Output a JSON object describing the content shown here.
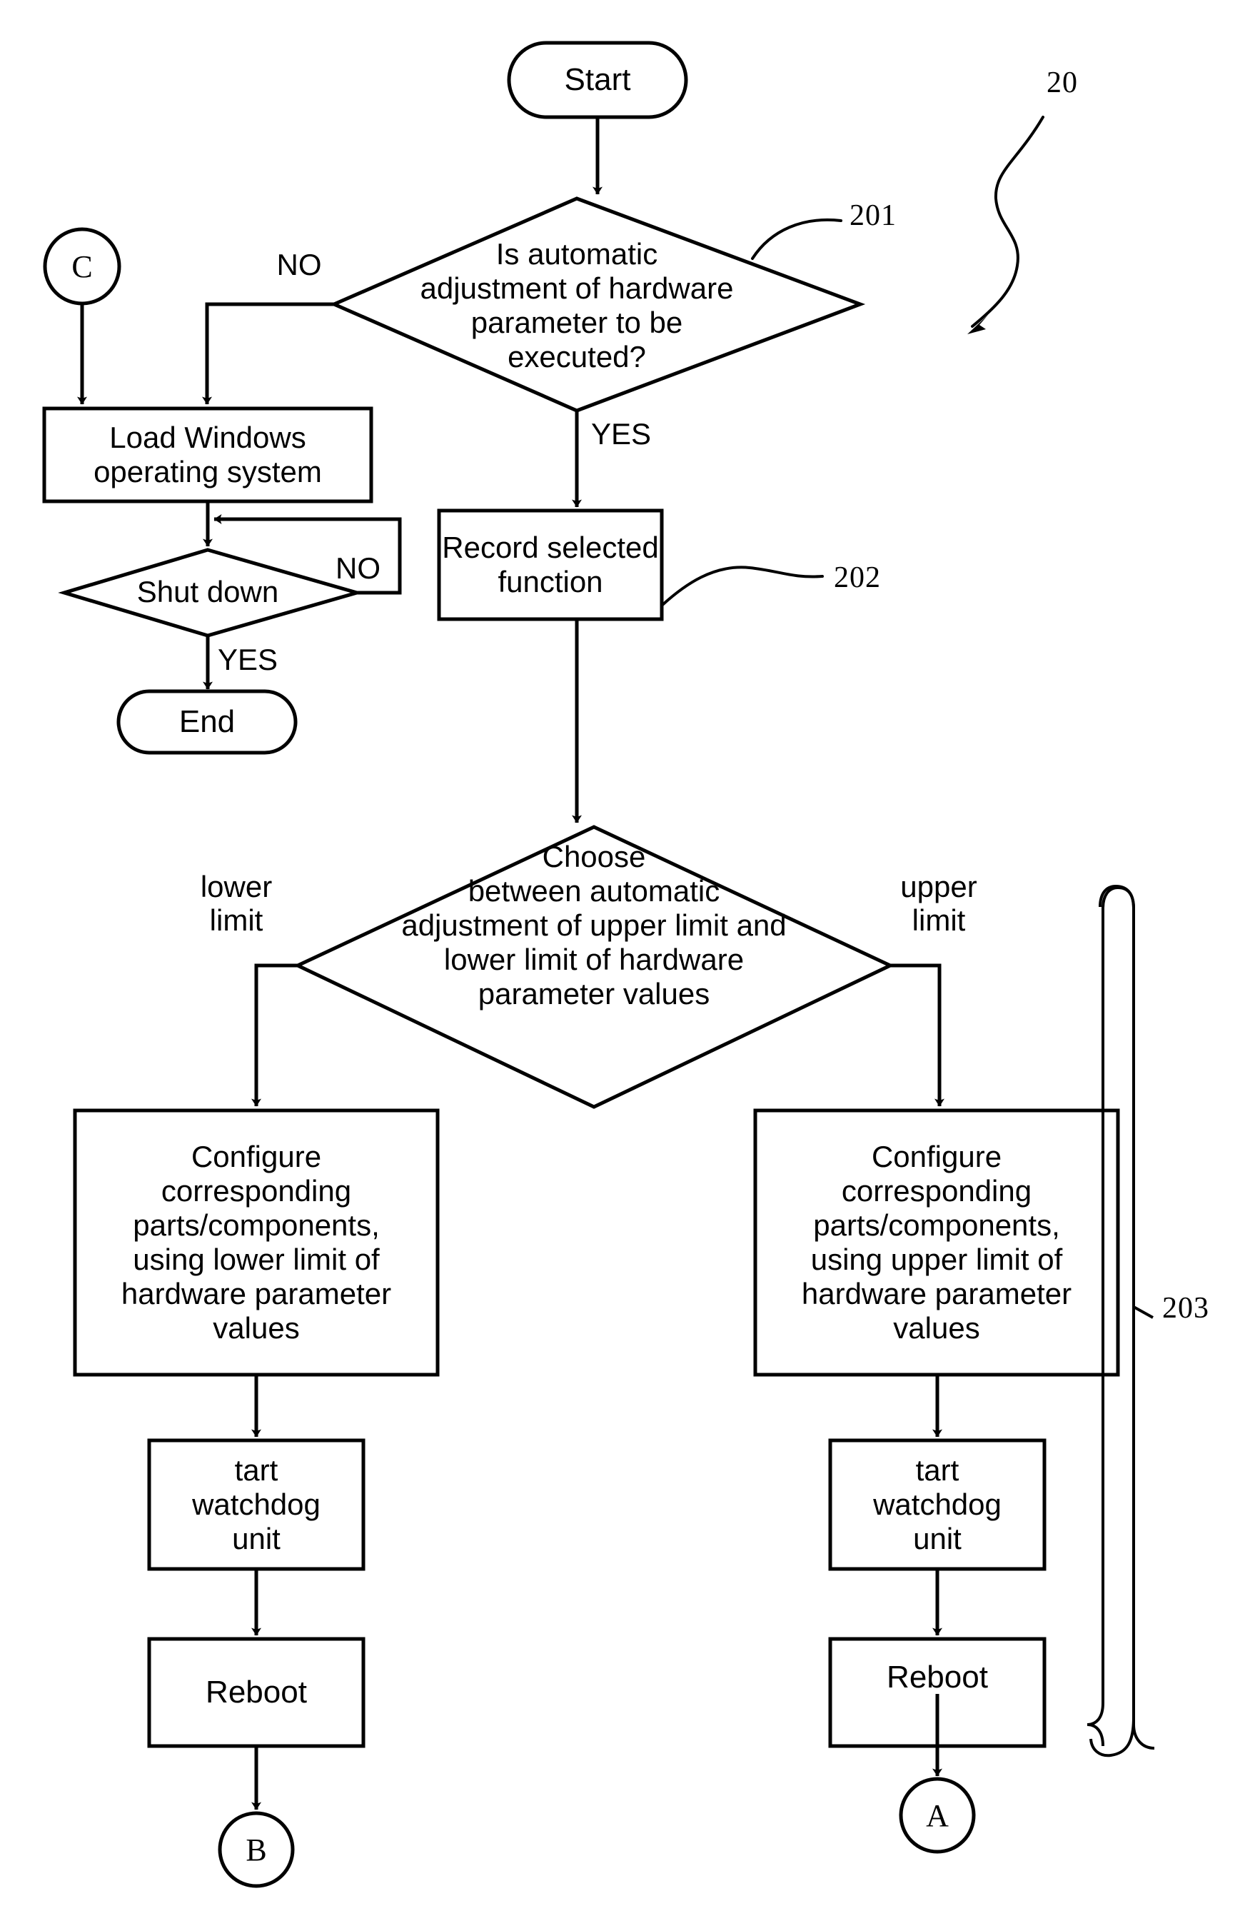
{
  "figure": {
    "type": "flowchart",
    "reference_numeral": "20"
  },
  "nodes": {
    "start": {
      "label": "Start",
      "shape": "stadium"
    },
    "decision_auto_adjust": {
      "label": "Is automatic\nadjustment of hardware\nparameter to be\nexecuted?",
      "shape": "diamond",
      "ref": "201"
    },
    "connector_c": {
      "label": "C",
      "shape": "circle"
    },
    "load_windows": {
      "label": "Load Windows\noperating system",
      "shape": "rect"
    },
    "decision_shutdown": {
      "label": "Shut down",
      "shape": "diamond"
    },
    "end": {
      "label": "End",
      "shape": "stadium"
    },
    "record_function": {
      "label": "Record selected\nfunction",
      "shape": "rect",
      "ref": "202"
    },
    "decision_choose": {
      "label": "Choose\nbetween automatic\nadjustment of upper limit and\nlower limit of hardware\nparameter values",
      "shape": "diamond"
    },
    "configure_lower": {
      "label": "Configure\ncorresponding\nparts/components,\nusing lower limit of\nhardware parameter\nvalues",
      "shape": "rect"
    },
    "configure_upper": {
      "label": "Configure\ncorresponding\nparts/components,\nusing upper limit of\nhardware parameter\nvalues",
      "shape": "rect"
    },
    "watchdog_left": {
      "label": "tart\nwatchdog\nunit",
      "shape": "rect"
    },
    "watchdog_right": {
      "label": "tart\nwatchdog\nunit",
      "shape": "rect"
    },
    "reboot_left": {
      "label": "Reboot",
      "shape": "rect"
    },
    "reboot_right": {
      "label": "Reboot",
      "shape": "rect"
    },
    "connector_b": {
      "label": "B",
      "shape": "circle"
    },
    "connector_a": {
      "label": "A",
      "shape": "circle"
    }
  },
  "edge_labels": {
    "no_auto_adjust": "NO",
    "yes_auto_adjust": "YES",
    "no_shutdown": "NO",
    "yes_shutdown": "YES",
    "lower_limit": "lower\nlimit",
    "upper_limit": "upper\nlimit"
  },
  "reference_labels": {
    "figure": "20",
    "decision_auto_adjust": "201",
    "record_function": "202",
    "branch_group": "203"
  },
  "colors": {
    "stroke": "#000000",
    "fill": "#ffffff",
    "text": "#000000"
  }
}
